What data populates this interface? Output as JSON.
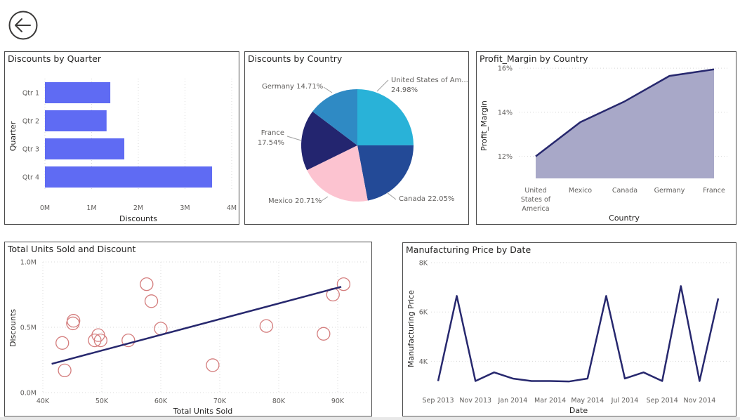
{
  "nav": {
    "back_icon": "arrow-left-circle-icon"
  },
  "colors": {
    "bar": "#5f6bf3",
    "line": "#27286e",
    "area": "#a8a8c8",
    "scatter": "#d47d7d",
    "pie": [
      "#29b2d8",
      "#234a97",
      "#fcc3d0",
      "#23256f",
      "#2f8ac4"
    ]
  },
  "panels": {
    "quarter": {
      "title": "Discounts by Quarter"
    },
    "country": {
      "title": "Discounts by Country"
    },
    "profit": {
      "title": "Profit_Margin by Country"
    },
    "units": {
      "title": "Total Units Sold and Discount"
    },
    "price": {
      "title": "Manufacturing Price by Date"
    }
  },
  "chart_data": [
    {
      "id": "quarter",
      "type": "bar",
      "orientation": "horizontal",
      "title": "Discounts by Quarter",
      "categories": [
        "Qtr 1",
        "Qtr 2",
        "Qtr 3",
        "Qtr 4"
      ],
      "values": [
        1.4,
        1.32,
        1.7,
        3.58
      ],
      "value_unit": "M",
      "xlabel": "Discounts",
      "ylabel": "Quarter",
      "xlim": [
        0,
        4
      ],
      "xticks": [
        "0M",
        "1M",
        "2M",
        "3M",
        "4M"
      ],
      "grid": true
    },
    {
      "id": "country",
      "type": "pie",
      "title": "Discounts by Country",
      "slices": [
        {
          "label": "United States of Am...",
          "value": 24.98,
          "pct": "24.98%"
        },
        {
          "label": "Canada",
          "value": 22.05,
          "pct": "22.05%"
        },
        {
          "label": "Mexico",
          "value": 20.71,
          "pct": "20.71%"
        },
        {
          "label": "France",
          "value": 17.54,
          "pct": "17.54%"
        },
        {
          "label": "Germany",
          "value": 14.71,
          "pct": "14.71%"
        }
      ]
    },
    {
      "id": "profit",
      "type": "area",
      "title": "Profit_Margin by Country",
      "categories": [
        "United States of America",
        "Mexico",
        "Canada",
        "Germany",
        "France"
      ],
      "values": [
        12.0,
        13.55,
        14.5,
        15.65,
        15.95
      ],
      "value_unit": "%",
      "xlabel": "Country",
      "ylabel": "Profit_Margin",
      "ylim": [
        11,
        16.1
      ],
      "yticks": [
        12,
        14,
        16
      ],
      "ytick_labels": [
        "12%",
        "14%",
        "16%"
      ]
    },
    {
      "id": "units",
      "type": "scatter",
      "title": "Total Units Sold and Discount",
      "xlabel": "Total Units Sold",
      "ylabel": "Discounts",
      "xlim": [
        40,
        95
      ],
      "ylim": [
        0,
        1.0
      ],
      "xticks": [
        40,
        50,
        60,
        70,
        80,
        90
      ],
      "xtick_labels": [
        "40K",
        "50K",
        "60K",
        "70K",
        "80K",
        "90K"
      ],
      "yticks": [
        0,
        0.5,
        1.0
      ],
      "ytick_labels": [
        "0.0M",
        "0.5M",
        "1.0M"
      ],
      "points": [
        [
          43.3,
          0.38
        ],
        [
          43.7,
          0.17
        ],
        [
          45.1,
          0.53
        ],
        [
          45.2,
          0.55
        ],
        [
          48.8,
          0.4
        ],
        [
          49.4,
          0.44
        ],
        [
          49.8,
          0.4
        ],
        [
          54.5,
          0.4
        ],
        [
          57.6,
          0.83
        ],
        [
          58.4,
          0.7
        ],
        [
          60.0,
          0.49
        ],
        [
          68.8,
          0.21
        ],
        [
          77.9,
          0.51
        ],
        [
          87.6,
          0.45
        ],
        [
          89.2,
          0.75
        ],
        [
          91.0,
          0.83
        ]
      ],
      "trend": [
        [
          41.5,
          0.22
        ],
        [
          90.6,
          0.81
        ]
      ]
    },
    {
      "id": "price",
      "type": "line",
      "title": "Manufacturing Price by Date",
      "xlabel": "Date",
      "ylabel": "Manufacturing Price",
      "ylim": [
        2.9,
        8.0
      ],
      "yticks": [
        4,
        6,
        8
      ],
      "ytick_labels": [
        "4K",
        "6K",
        "8K"
      ],
      "x_labels": [
        "Sep 2013",
        "Nov 2013",
        "Jan 2014",
        "Mar 2014",
        "May 2014",
        "Jul 2014",
        "Sep 2014",
        "Nov 2014"
      ],
      "points": [
        [
          "Sep 2013",
          3.2
        ],
        [
          "Oct 2013",
          6.65
        ],
        [
          "Nov 2013",
          3.2
        ],
        [
          "Dec 2013",
          3.55
        ],
        [
          "Jan 2014",
          3.3
        ],
        [
          "Feb 2014",
          3.2
        ],
        [
          "Mar 2014",
          3.2
        ],
        [
          "Apr 2014",
          3.18
        ],
        [
          "May 2014",
          3.3
        ],
        [
          "Jun 2014",
          6.65
        ],
        [
          "Jul 2014",
          3.3
        ],
        [
          "Aug 2014",
          3.55
        ],
        [
          "Sep 2014",
          3.2
        ],
        [
          "Oct 2014",
          7.05
        ],
        [
          "Nov 2014",
          3.2
        ],
        [
          "Dec 2014",
          6.55
        ]
      ]
    }
  ]
}
